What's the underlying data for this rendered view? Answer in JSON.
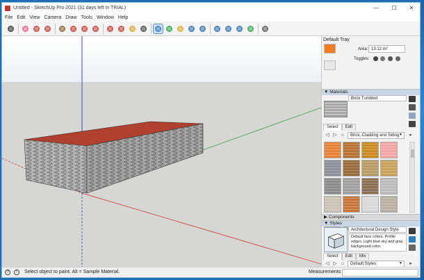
{
  "app": {
    "title": "Untitled - SketchUp Pro 2021 (31 days left in TRIAL)",
    "icon": "sketchup-logo-icon"
  },
  "window_controls": {
    "minimize": "—",
    "maximize": "☐",
    "close": "✕"
  },
  "menu": [
    "File",
    "Edit",
    "View",
    "Camera",
    "Draw",
    "Tools",
    "Window",
    "Help"
  ],
  "toolbar": {
    "tools": [
      {
        "name": "select-tool-icon",
        "color": "#333333"
      },
      {
        "name": "eraser-tool-icon",
        "color": "#e85a8a"
      },
      {
        "name": "line-tool-icon",
        "color": "#c0392b"
      },
      {
        "name": "arc-tool-icon",
        "color": "#c0392b"
      },
      {
        "name": "rectangle-tool-icon",
        "color": "#8a5a2b"
      },
      {
        "name": "push-pull-tool-icon",
        "color": "#c0392b"
      },
      {
        "name": "move-tool-icon",
        "color": "#c0392b"
      },
      {
        "name": "rotate-tool-icon",
        "color": "#c0392b"
      },
      {
        "name": "scale-tool-icon",
        "color": "#c0392b"
      },
      {
        "name": "offset-tool-icon",
        "color": "#c0392b"
      },
      {
        "name": "tape-measure-tool-icon",
        "color": "#d8a52b"
      },
      {
        "name": "text-tool-icon",
        "color": "#444444"
      },
      {
        "name": "paint-bucket-tool-icon",
        "color": "#2b7bc0",
        "active": true
      },
      {
        "name": "orbit-tool-icon",
        "color": "#2aa14a"
      },
      {
        "name": "pan-tool-icon",
        "color": "#d8a52b"
      },
      {
        "name": "zoom-tool-icon",
        "color": "#2b6cb0"
      },
      {
        "name": "zoom-extents-tool-icon",
        "color": "#2b6cb0"
      },
      {
        "name": "3d-warehouse-icon",
        "color": "#2b6cb0"
      },
      {
        "name": "extension-warehouse-icon",
        "color": "#2b6cb0"
      },
      {
        "name": "layout-icon",
        "color": "#2b6cb0"
      },
      {
        "name": "extension-manager-icon",
        "color": "#2aa14a"
      },
      {
        "name": "account-icon",
        "color": "#555555"
      }
    ]
  },
  "tray": {
    "title": "Default Tray",
    "entity_info": {
      "area_label": "Area:",
      "area_value": "13.12 m²",
      "toggles_label": "Toggles:",
      "face_color": "#f47c1e"
    },
    "materials": {
      "header": "Materials",
      "current_name": "Brick Tumbled",
      "tabs": [
        "Select",
        "Edit"
      ],
      "active_tab": "Select",
      "library": "Brick, Cladding and Siding",
      "swatches": [
        "#e98237",
        "#b87333",
        "#c98a22",
        "#f2a6a6",
        "#8e8e9a",
        "#9a6b3a",
        "#b89a66",
        "#c9a25a",
        "#8c8c8c",
        "#a0a0a0",
        "#8a6f55",
        "#bcbcbc",
        "#c9c2b5",
        "#c8753a",
        "#d9d9d9",
        "#b8b1a3",
        "#b7ad9a",
        "#a8a8a8",
        "#c26b5a",
        "#9c9c9c"
      ]
    },
    "components": {
      "header": "Components"
    },
    "styles": {
      "header": "Styles",
      "name": "Architectural Design Style",
      "description": "Default face colors. Profile edges. Light blue sky and gray background color.",
      "tabs": [
        "Select",
        "Edit",
        "Mix"
      ],
      "active_tab": "Select",
      "collection": "Default Styles"
    }
  },
  "status": {
    "text": "Select object to paint. Alt = Sample Material.",
    "measurements_label": "Measurements",
    "measurements_value": ""
  },
  "colors": {
    "roof": "#b0402f",
    "brick": "#9e9e9e",
    "axis_red": "#d23a2a",
    "axis_green": "#3aa13a",
    "axis_blue": "#4040d0"
  }
}
